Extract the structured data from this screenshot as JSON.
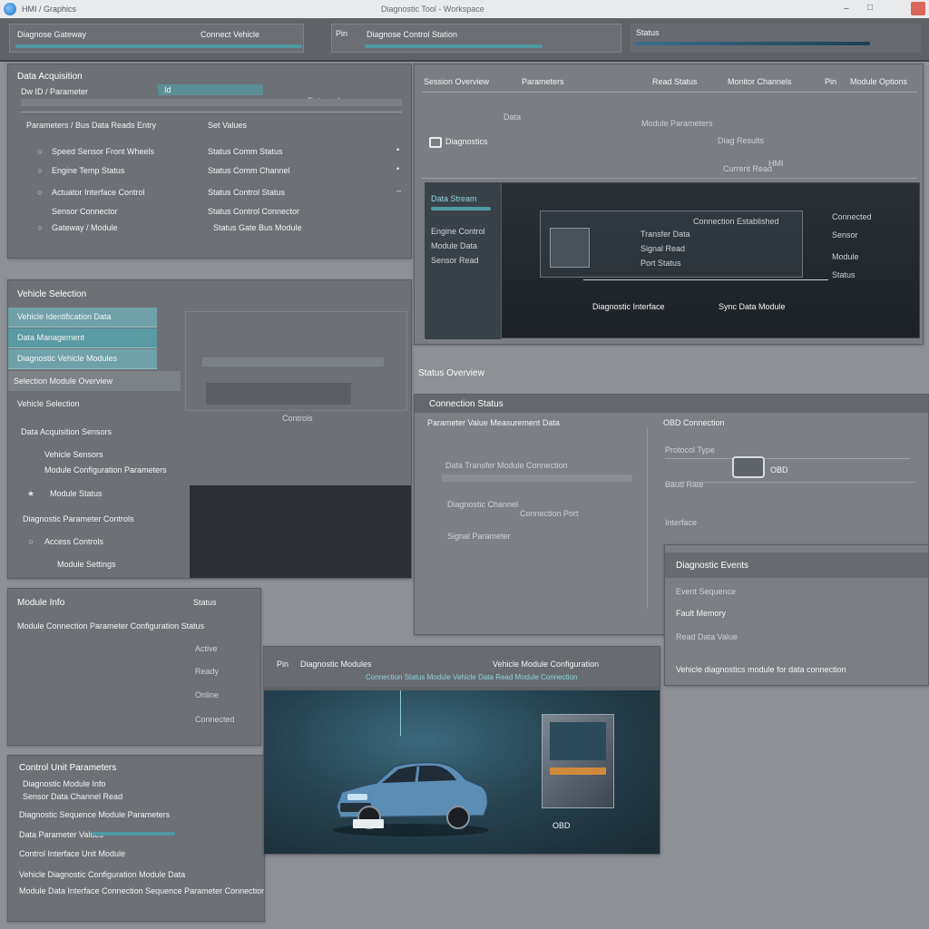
{
  "window": {
    "title": "Diagnostic Tool - Workspace",
    "tab_label": "HMI / Graphics",
    "minimize": "–",
    "maximize": "□",
    "close": "✕"
  },
  "toolbar": {
    "section1": "Diagnose Gateway",
    "section2": "Connect Vehicle",
    "section3": "Pin",
    "section4": "Diagnose Control Station",
    "section5": "Status"
  },
  "panel_a": {
    "title": "Data Acquisition",
    "filter_label": "Dw ID / Parameter",
    "filter_value": "Id",
    "search_hint": "Enter value",
    "subheader_left": "Parameters / Bus Data Reads Entry",
    "subheader_right": "Set Values",
    "rows": [
      {
        "left": "Speed Sensor Front Wheels",
        "right": "Status Comm Status",
        "marker": "•"
      },
      {
        "left": "Engine Temp Status",
        "right": "Status Comm Channel",
        "marker": "•"
      },
      {
        "left": "Actuator Interface Control",
        "right": "Status Control Status",
        "marker": "–"
      },
      {
        "left": "Sensor Connector",
        "right": "Status Control Connector",
        "marker": ""
      },
      {
        "left": "Gateway / Module",
        "right": "Status Gate Bus Module",
        "marker": ""
      }
    ]
  },
  "panel_b": {
    "title": "Vehicle Selection",
    "menu": [
      "Vehicle Identification Data",
      "Data Management",
      "Diagnostic Vehicle Modules"
    ],
    "sub_left": "Selection Module Overview",
    "sub_header": "Vehicle Selection",
    "list": [
      "Data Acquisition Sensors",
      "Vehicle Sensors",
      "Module Configuration Parameters",
      "Module Status",
      "Diagnostic Parameter Controls",
      "Access Controls",
      "Module Settings"
    ],
    "center_label": "Controls"
  },
  "panel_c": {
    "tabs": [
      "Session Overview",
      "Parameters",
      "Read Status",
      "Monitor Channels",
      "Pin",
      "Module Options"
    ],
    "col_left": "Data",
    "col_mid": "Module Parameters",
    "col_mid2": "Diag Results",
    "col_right": "Current Read",
    "logo_label": "Diagnostics",
    "readout": "HMI",
    "screen": {
      "sidebar_title": "Data Stream",
      "sidebar_items": [
        "Engine Control",
        "Module Data",
        "Sensor Read"
      ],
      "dialog_title": "Connection Established",
      "dialog_lines": [
        "Transfer Data",
        "Signal Read",
        "Port Status"
      ],
      "right_items": [
        "Connected",
        "Sensor",
        "Module",
        "Status"
      ],
      "bottom_left": "Diagnostic Interface",
      "bottom_right": "Sync Data Module"
    }
  },
  "panel_d": {
    "caption": "Status Overview",
    "title": "Connection Status",
    "left_header": "Parameter Value Measurement Data",
    "right_header": "OBD Connection",
    "fields": [
      "Data Transfer Module Connection",
      "Diagnostic Channel",
      "Connection Port",
      "Signal Parameter"
    ],
    "right_fields": [
      "Protocol Type",
      "Baud Rate",
      "Interface"
    ],
    "plug_label": "OBD"
  },
  "panel_e": {
    "title": "Diagnostic Events",
    "items": [
      "Event Sequence",
      "Fault Memory",
      "Read Data Value"
    ],
    "footer": "Vehicle diagnostics module for data connection"
  },
  "panel_f": {
    "title": "Module Info",
    "right_title": "Status",
    "line": "Module Connection Parameter Configuration Status",
    "values": [
      "Active",
      "Ready",
      "Online",
      "Connected"
    ]
  },
  "panel_g": {
    "title": "Control Unit Parameters",
    "lines": [
      "Diagnostic Module Info",
      "Sensor Data Channel Read",
      "Diagnostic Sequence Module Parameters",
      "Data Parameter Values",
      "Control Interface Unit Module",
      "Vehicle Diagnostic Configuration Module Data",
      "Module Data Interface Connection Sequence Parameter Connection"
    ]
  },
  "panel_h": {
    "tab1": "Pin",
    "tab2": "Diagnostic Modules",
    "tab3": "Vehicle Module Configuration",
    "subtitle": "Connection Status Module Vehicle Data Read Module Connection",
    "plate": "OBD"
  },
  "colors": {
    "accent": "#4f9aa0",
    "panel": "#6d7176",
    "background": "#8d9196",
    "screen_dark": "#2c3136",
    "car_body": "#5c8db5"
  }
}
